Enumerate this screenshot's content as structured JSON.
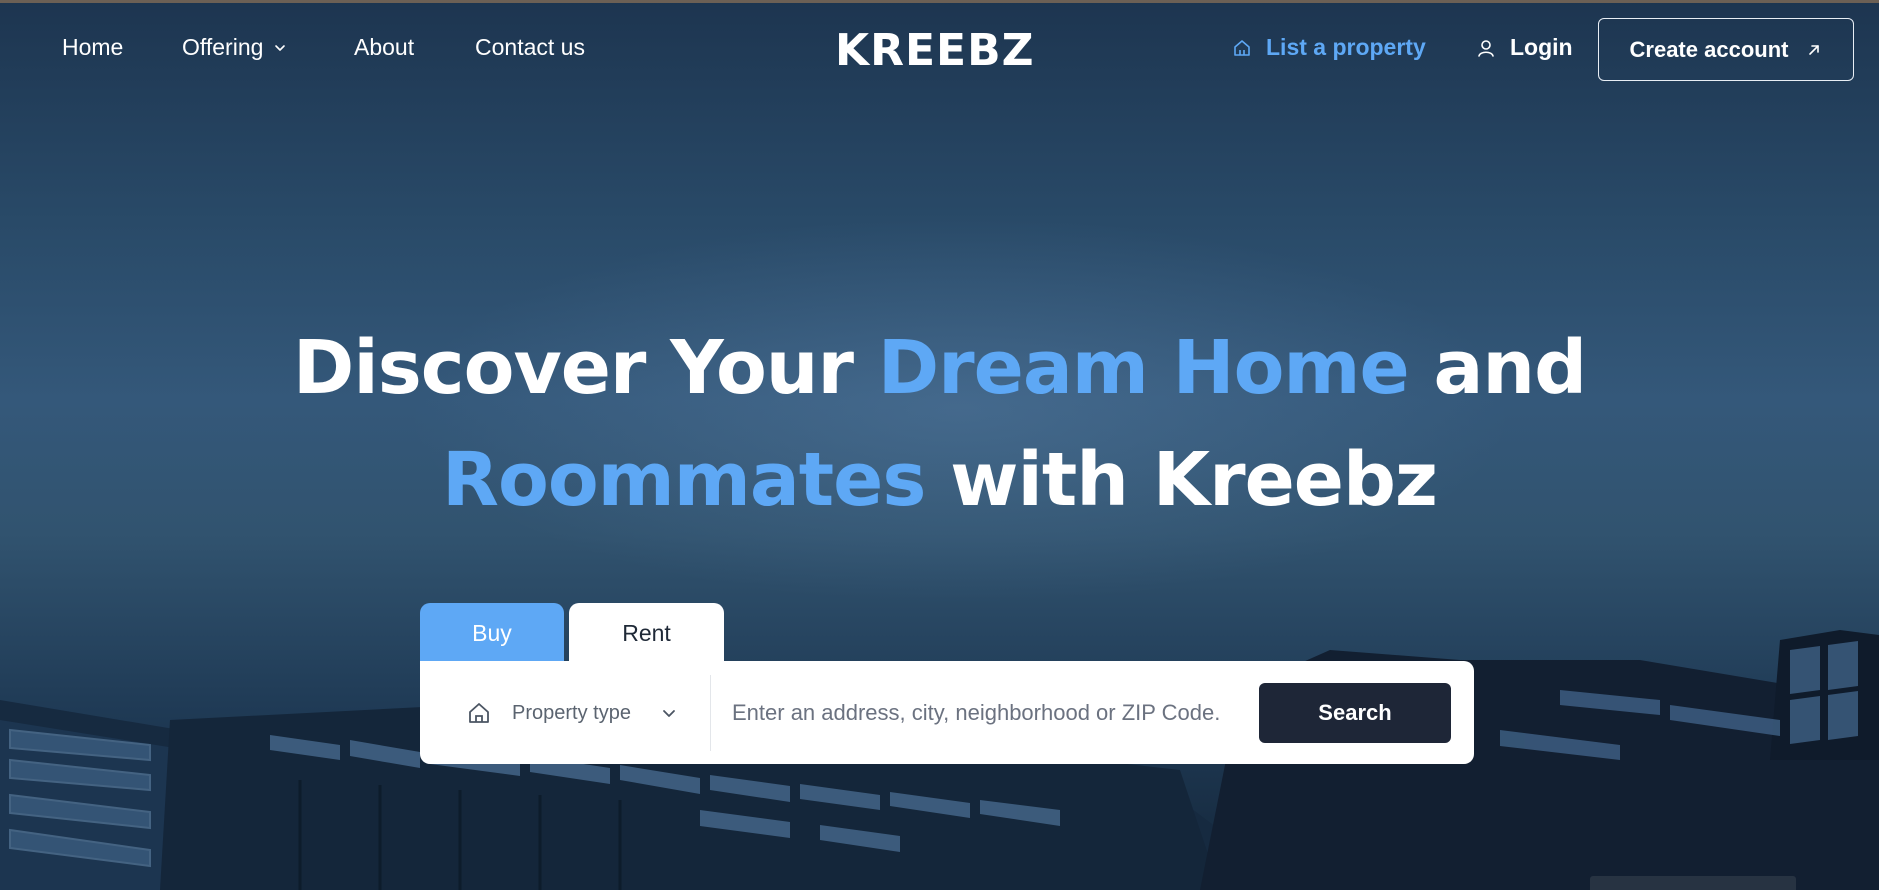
{
  "nav": {
    "home": "Home",
    "offering": "Offering",
    "about": "About",
    "contact": "Contact us"
  },
  "logo": {
    "text": "KREEBZ"
  },
  "actions": {
    "list_property": "List a property",
    "login": "Login",
    "create_account": "Create account"
  },
  "hero": {
    "line1_a": "Discover Your ",
    "line1_accent": "Dream Home",
    "line1_b": " and",
    "line2_accent": "Roommates",
    "line2_b": " with Kreebz"
  },
  "search": {
    "tabs": [
      "Buy",
      "Rent"
    ],
    "active_tab": "Rent",
    "property_type_label": "Property type",
    "address_placeholder": "Enter an address, city, neighborhood or ZIP Code.",
    "button_label": "Search"
  },
  "colors": {
    "accent": "#5ea8f5",
    "search_button": "#1e2637",
    "background": "#294a68"
  },
  "icons": {
    "list_property": "home-icon",
    "login": "user-icon",
    "create_account": "arrow-up-right-icon",
    "property_type": "home-icon",
    "dropdown": "chevron-down-icon"
  }
}
